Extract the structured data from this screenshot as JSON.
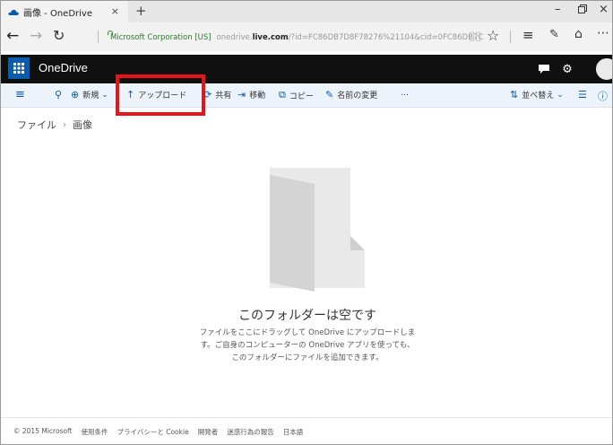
{
  "browser": {
    "tab_title": "画像 - OneDrive",
    "tab_close": "×",
    "new_tab": "+",
    "window_controls": {
      "minimize": "–",
      "restore": "ਰ",
      "close": "×"
    },
    "address": {
      "cert": "Microsoft Corporation [US]",
      "url_prefix": "onedrive.",
      "url_domain": "live.com",
      "url_rest": "/?id=FC86DB7D8F78276%21104&cid=0FC86DB7C"
    }
  },
  "onedrive": {
    "brand": "OneDrive",
    "commands": {
      "new": "新規",
      "upload": "アップロード",
      "share": "共有",
      "move": "移動",
      "copy": "コピー",
      "rename": "名前の変更",
      "more": "…",
      "sort": "並べ替え"
    },
    "breadcrumb": {
      "root": "ファイル",
      "current": "画像",
      "separator": "›"
    },
    "empty": {
      "title": "このフォルダーは空です",
      "desc_line1": "ファイルをここにドラッグして OneDrive にアップロードしま",
      "desc_line2": "す。ご自身のコンピューターの OneDrive アプリを使っても、",
      "desc_line3": "このフォルダーにファイルを追加できます。"
    },
    "footer": {
      "copyright": "© 2015 Microsoft",
      "terms": "使用条件",
      "privacy": "プライバシーと Cookie",
      "developers": "開発者",
      "report": "迷惑行為の報告",
      "language": "日本語"
    }
  },
  "colors": {
    "brand_blue": "#0b5cad",
    "header_bg": "#101010",
    "command_bar_bg": "#edf3fb",
    "highlight": "#e8141a"
  },
  "icons": {
    "waffle": "app-launcher-icon",
    "search": "search-icon",
    "new": "plus-circle-icon",
    "upload": "upload-arrow-icon",
    "share": "share-icon",
    "move": "move-icon",
    "copy": "copy-icon",
    "rename": "rename-icon",
    "sort": "sort-icon",
    "view": "list-view-icon",
    "info": "info-icon"
  }
}
